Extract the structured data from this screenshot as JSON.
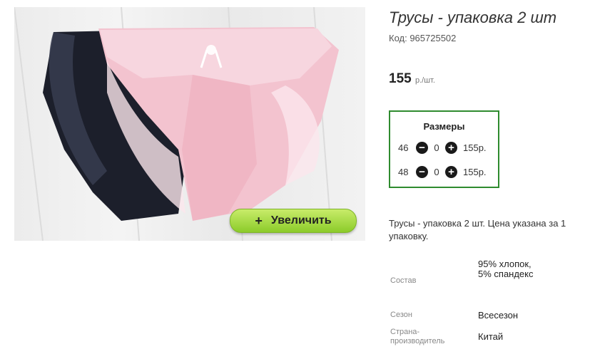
{
  "product": {
    "title": "Трусы - упаковка 2 шт",
    "code": "Код: 965725502",
    "price_value": "155",
    "price_unit": "р./шт.",
    "zoom_button": {
      "icon": "+",
      "label": "Увеличить"
    }
  },
  "sizes": {
    "title": "Размеры",
    "rows": [
      {
        "size": "46",
        "qty": "0",
        "price": "155р."
      },
      {
        "size": "48",
        "qty": "0",
        "price": "155р."
      }
    ]
  },
  "description": "Трусы - упаковка 2 шт. Цена указана за 1 упаковку.",
  "attributes": [
    {
      "label": "Состав",
      "value": "95% хлопок, 5% спандекс"
    },
    {
      "label": "Сезон",
      "value": "Всесезон"
    },
    {
      "label": "Страна-производитель",
      "value": "Китай"
    }
  ],
  "colors": {
    "border_green": "#2e8b2e",
    "button_green": "#8ccb2a"
  }
}
